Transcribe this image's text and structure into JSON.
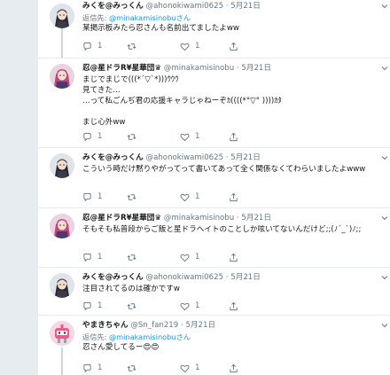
{
  "tweets": [
    {
      "name": "みくを@みっくん",
      "handle": "@ahonokiwami0625",
      "dot": "·",
      "date": "5月21日",
      "reply_prefix": "返信先:",
      "reply_mention": "@minakamisinobu",
      "reply_suffix": "さん",
      "text": "某掲示板みたら忍さんも名前出てましたよww",
      "replies": "1",
      "retweets": "",
      "likes": "1",
      "avatar": "dark-hair-character"
    },
    {
      "name": "忍@星ドラR¥星華団♛",
      "handle": "@minakamisinobu",
      "dot": "·",
      "date": "5月21日",
      "text": "まじでまじで(((*´▽`*)))ｳｳｳ\n見てきた…\n…って私ごんぢ君の応援キャラじゃねーぞｶ((((*°▽° ))))ｶﾀ\n\nまじ心外ww",
      "replies": "1",
      "retweets": "",
      "likes": "1",
      "avatar": "pink-hair-character"
    },
    {
      "name": "みくを@みっくん",
      "handle": "@ahonokiwami0625",
      "dot": "·",
      "date": "5月21日",
      "text": "こういう時だけ黙りやがってって書いてあって全く関係なくてわらいましたよwww",
      "replies": "1",
      "retweets": "",
      "likes": "1",
      "avatar": "dark-hair-character"
    },
    {
      "name": "忍@星ドラR¥星華団♛",
      "handle": "@minakamisinobu",
      "dot": "·",
      "date": "5月21日",
      "text": "そもそも私普段からご飯と星ドラへイトのことしか呟いてないんだけど;;(ﾉ´_`)ﾉ;;",
      "replies": "1",
      "retweets": "",
      "likes": "1",
      "avatar": "pink-hair-character"
    },
    {
      "name": "みくを@みっくん",
      "handle": "@ahonokiwami0625",
      "dot": "·",
      "date": "5月21日",
      "text": "注目されてるのは確かですw",
      "replies": "1",
      "retweets": "",
      "likes": "1",
      "avatar": "dark-hair-character"
    },
    {
      "name": "やまきちゃん",
      "handle": "@Sn_fan219",
      "dot": "·",
      "date": "5月21日",
      "reply_prefix": "返信先:",
      "reply_mention": "@minakamisinobu",
      "reply_suffix": "さん",
      "text": "忍さん愛してるー😍😍",
      "replies": "1",
      "retweets": "",
      "likes": "1",
      "avatar": "pink-robot-character"
    }
  ],
  "colors": {
    "background": "#e6ecf0",
    "card": "#ffffff",
    "link": "#1b95e0",
    "muted": "#657786",
    "thread_line": "#ccd6dd"
  }
}
